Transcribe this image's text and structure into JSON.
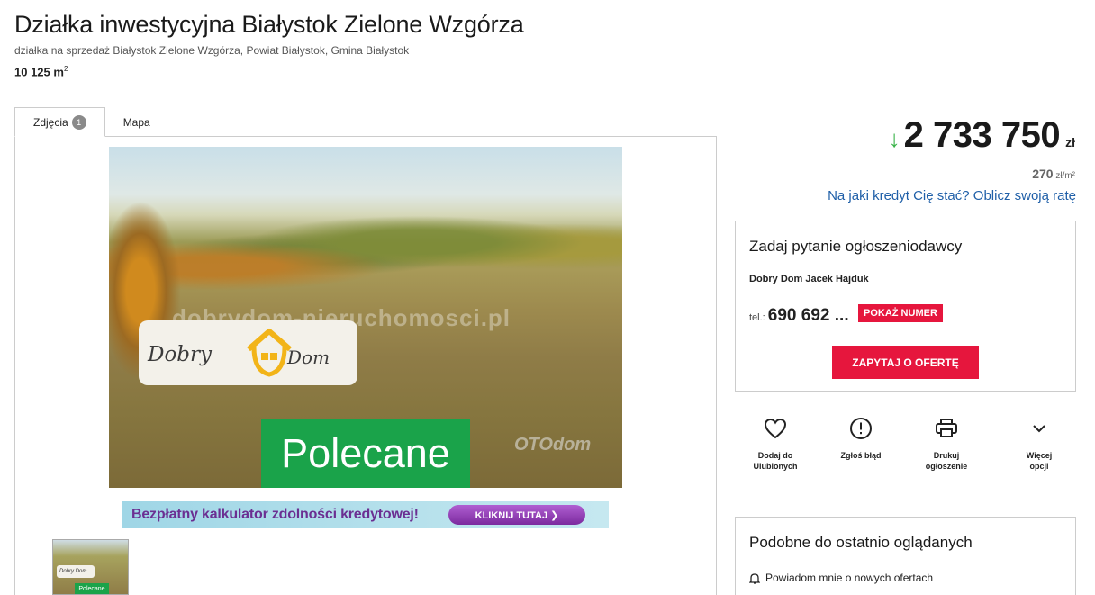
{
  "listing": {
    "title": "Działka inwestycyjna Białystok Zielone Wzgórza",
    "subtitle": "działka na sprzedaż Białystok Zielone Wzgórza, Powiat Białystok, Gmina Białystok",
    "area_value": "10 125 m",
    "area_unit_sup": "2"
  },
  "tabs": [
    {
      "label": "Zdjęcia",
      "badge": "1"
    },
    {
      "label": "Mapa"
    }
  ],
  "photo": {
    "watermark": "dobrydom-nieruchomosci.pl",
    "logo_word1": "Dobry",
    "logo_word2": "Dom",
    "overlay_label": "Polecane",
    "stamp": "OTOdom"
  },
  "banner": {
    "text": "Bezpłatny kalkulator zdolności kredytowej!",
    "button": "KLIKNIJ TUTAJ ❯"
  },
  "thumbnail": {
    "logo": "Dobry  Dom",
    "label": "Polecane"
  },
  "price": {
    "value": "2 733 750",
    "currency": "zł",
    "per_m2_value": "270",
    "per_m2_unit": " zł/m²",
    "credit_link": "Na jaki kredyt Cię stać? Oblicz swoją ratę",
    "trend_icon": "arrow-down",
    "trend_color": "#3bb34a"
  },
  "contact": {
    "heading": "Zadaj pytanie ogłoszeniodawcy",
    "agent": "Dobry Dom Jacek Hajduk",
    "tel_prefix": "tel.:",
    "tel_value": "690 692 ...",
    "show_number": "POKAŻ NUMER",
    "ask_button": "ZAPYTAJ O OFERTĘ",
    "accent": "#e6163d"
  },
  "actions": [
    {
      "icon": "heart-icon",
      "label1": "Dodaj do",
      "label2": "Ulubionych"
    },
    {
      "icon": "alert-icon",
      "label1": "Zgłoś błąd",
      "label2": ""
    },
    {
      "icon": "printer-icon",
      "label1": "Drukuj",
      "label2": "ogłoszenie"
    },
    {
      "icon": "chevron-down-icon",
      "label1": "Więcej",
      "label2": "opcji"
    }
  ],
  "similar": {
    "heading": "Podobne do ostatnio oglądanych",
    "notify": "Powiadom mnie o nowych ofertach"
  }
}
